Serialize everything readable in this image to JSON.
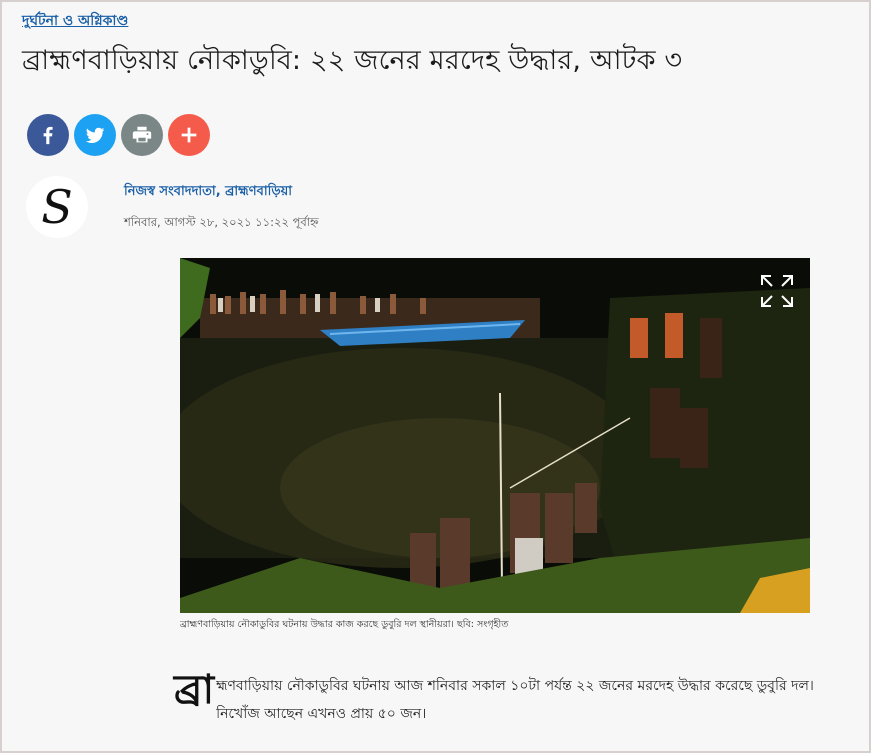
{
  "article": {
    "category": "দুর্ঘটনা ও অগ্নিকাণ্ড",
    "headline": "ব্রাহ্মণবাড়িয়ায় নৌকাডুবি: ২২ জনের মরদেহ উদ্ধার, আটক ৩",
    "author": "নিজস্ব সংবাদদাতা, ব্রাহ্মণবাড়িয়া",
    "date": "শনিবার, আগস্ট ২৮, ২০২১ ১১:২২ পূর্বাহ্ন",
    "caption": "ব্রাহ্মণবাড়িয়ায় নৌকাডুবির ঘটনায় উদ্ধার কাজ করছে ডুবুরি দল স্থানীয়রা। ছবি: সংগৃহীত",
    "dropcap": "ব্রা",
    "body": "হ্মণবাড়িয়ায় নৌকাডুবির ঘটনায় আজ শনিবার সকাল ১০টা পর্যন্ত ২২ জনের মরদেহ উদ্ধার করেছে ডুবুরি দল। নিখোঁজ আছেন এখনও প্রায় ৫০ জন।",
    "logo_letter": "S"
  },
  "share": {
    "buttons": [
      {
        "icon": "facebook-icon",
        "color": "#3b5998"
      },
      {
        "icon": "twitter-icon",
        "color": "#1da1f2"
      },
      {
        "icon": "print-icon",
        "color": "#7b8787"
      },
      {
        "icon": "plus-icon",
        "color": "#f55b4a"
      }
    ]
  },
  "colors": {
    "link": "#1a5fa6",
    "background": "#f7f7f8"
  }
}
